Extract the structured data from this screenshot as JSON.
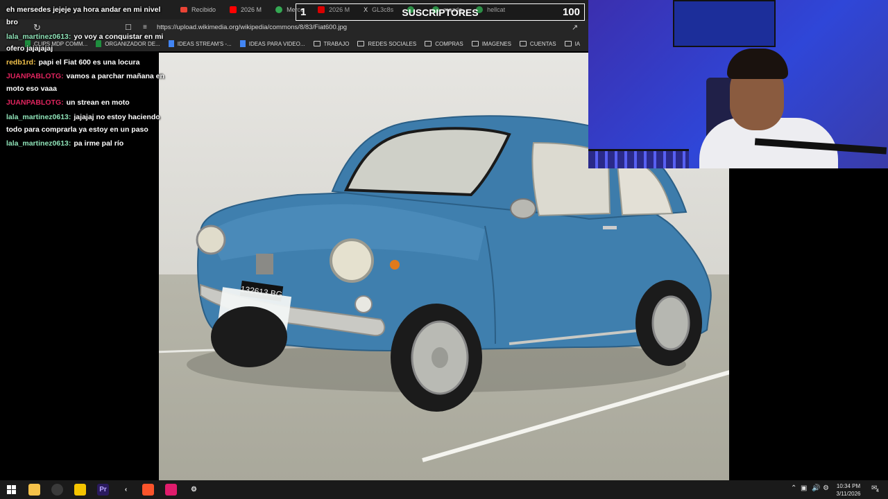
{
  "browser": {
    "tabs": [
      {
        "icon": "gmail-icon",
        "label": "Recibido",
        "color": "#ea4335"
      },
      {
        "icon": "youtube-icon",
        "label": "2026 M",
        "color": "#ff0000"
      },
      {
        "icon": "chrome-icon",
        "label": "Merce",
        "color": "#34a853"
      },
      {
        "icon": "youtube-icon",
        "label": "2026 M",
        "color": "#ff0000"
      },
      {
        "icon": "x-icon",
        "label": "GL3c8s",
        "color": "#ffffff"
      },
      {
        "icon": "chrome-icon",
        "label": "",
        "color": "#34a853"
      },
      {
        "icon": "chrome-icon",
        "label": "mazda",
        "color": "#34a853"
      },
      {
        "icon": "chrome-icon",
        "label": "hellcat",
        "color": "#34a853"
      }
    ],
    "url": "https://upload.wikimedia.org/wikipedia/commons/8/83/Fiat600.jpg",
    "bookmarks": [
      {
        "label": "CLIPS MDP COMM...",
        "icon": "sheet"
      },
      {
        "label": "ORGANIZADOR DE...",
        "icon": "sheet"
      },
      {
        "label": "IDEAS STREAM'S -...",
        "icon": "doc"
      },
      {
        "label": "IDEAS PARA VIDEO...",
        "icon": "doc"
      },
      {
        "label": "TRABAJO",
        "icon": "folder"
      },
      {
        "label": "REDES SOCIALES",
        "icon": "folder"
      },
      {
        "label": "COMPRAS",
        "icon": "folder"
      },
      {
        "label": "IMAGENES",
        "icon": "folder"
      },
      {
        "label": "CUENTAS",
        "icon": "folder"
      },
      {
        "label": "IA",
        "icon": "folder"
      }
    ]
  },
  "subscribers": {
    "current": "1",
    "title": "SUSCRIPTORES",
    "goal": "100"
  },
  "chat": [
    {
      "user": "",
      "text": "eh mersedes jejeje ya hora andar en mi nivel",
      "color": "#ffffff"
    },
    {
      "user": "",
      "text": "bro",
      "color": "#ffffff"
    },
    {
      "user": "lala_martinez0613:",
      "text": "yo voy a conquistar en mi",
      "color": "#8fe3b8"
    },
    {
      "user": "",
      "text": "ofero jajajajaj",
      "color": "#ffffff"
    },
    {
      "user": "redb1rd:",
      "text": "papi el Fiat 600 es una locura",
      "color": "#f3c24b"
    },
    {
      "user": "JUANPABLOTG:",
      "text": "vamos a parchar mañana en",
      "color": "#e0245e"
    },
    {
      "user": "",
      "text": "moto eso vaaa",
      "color": "#ffffff"
    },
    {
      "user": "JUANPABLOTG:",
      "text": "un strean en moto",
      "color": "#e0245e"
    },
    {
      "user": "lala_martinez0613:",
      "text": "jajajaj no estoy haciendo",
      "color": "#8fe3b8"
    },
    {
      "user": "",
      "text": "todo para comprarla ya estoy en un paso",
      "color": "#ffffff"
    },
    {
      "user": "lala_martinez0613:",
      "text": "pa irme pal río",
      "color": "#8fe3b8"
    }
  ],
  "car": {
    "plate": "132613 BG"
  },
  "taskbar": {
    "time": "10:34 PM",
    "date": "3/11/2026",
    "notifications": "4"
  }
}
